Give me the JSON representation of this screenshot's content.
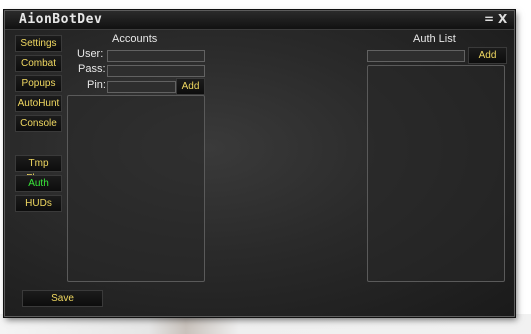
{
  "window": {
    "title": "AionBotDev",
    "minimize_glyph": "=",
    "close_glyph": "X"
  },
  "sidebar": {
    "items": [
      {
        "label": "Settings"
      },
      {
        "label": "Combat"
      },
      {
        "label": "Popups"
      },
      {
        "label": "AutoHunt"
      },
      {
        "label": "Console"
      },
      {
        "label": "Tmp Flags"
      },
      {
        "label": "Auth",
        "active": true
      },
      {
        "label": "HUDs"
      }
    ]
  },
  "accounts": {
    "heading": "Accounts",
    "user_label": "User:",
    "pass_label": "Pass:",
    "pin_label": "Pin:",
    "user_value": "",
    "pass_value": "",
    "pin_value": "",
    "add_label": "Add"
  },
  "auth_list": {
    "heading": "Auth List",
    "input_value": "",
    "add_label": "Add"
  },
  "footer": {
    "save_label": "Save"
  },
  "colors": {
    "button_text": "#f0d860",
    "active_text": "#39e839",
    "label_text": "#e8e8e8"
  }
}
